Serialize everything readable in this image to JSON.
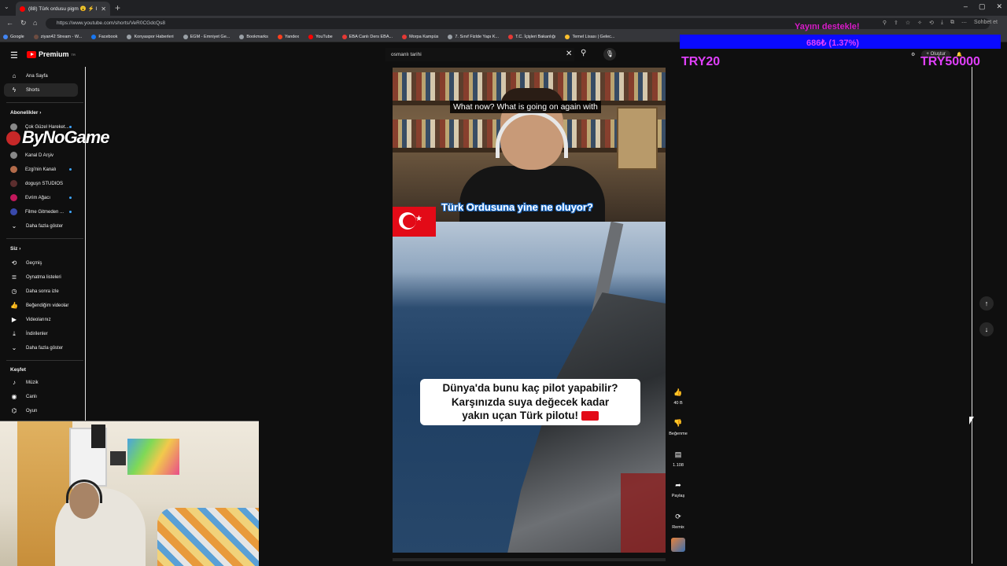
{
  "browser": {
    "tab_title": "(88) Türk ordusu pigm 😮 ⚡ I",
    "url": "https://www.youtube.com/shorts/VeR0CGdcQs8",
    "chat_label": "Sohbet et",
    "bookmarks": [
      {
        "label": "Google",
        "color": "#4285f4"
      },
      {
        "label": "ziyan42 Stream - W...",
        "color": "#6d4c41"
      },
      {
        "label": "Facebook",
        "color": "#1877f2"
      },
      {
        "label": "Konyaspor Haberleri",
        "color": "#9aa0a6"
      },
      {
        "label": "EGM - Emniyet Ge...",
        "color": "#9aa0a6"
      },
      {
        "label": "Bookmarks",
        "color": "#9aa0a6"
      },
      {
        "label": "Yandex",
        "color": "#fc3f1d"
      },
      {
        "label": "YouTube",
        "color": "#ff0000"
      },
      {
        "label": "EBA Canlı Ders EBA...",
        "color": "#e53935"
      },
      {
        "label": "Morpa Kampüs",
        "color": "#e53935"
      },
      {
        "label": "7. Sınıf Fizlde Yapı K...",
        "color": "#9aa0a6"
      },
      {
        "label": "T.C. İçişleri Bakanlığı",
        "color": "#e53935"
      },
      {
        "label": "Temel Lisası | Gelec...",
        "color": "#fbc02d"
      }
    ]
  },
  "overlay": {
    "title": "Yayını destekle!",
    "amount": "686₺ (1.37%)",
    "goal_left": "TRY20",
    "goal_right": "TRY50000"
  },
  "header": {
    "logo": "Premium",
    "logo_sup": "TR",
    "search_value": "osmanlı tarihi",
    "create_label": "Oluştur"
  },
  "sidebar": {
    "home": "Ana Sayfa",
    "shorts": "Shorts",
    "subs_head": "Abonelikler",
    "channels": [
      "Çok Güzel Hareket...",
      "Kanal D Arşiv",
      "Ezgi'nin Kanalı",
      "doguşn STUDIOS",
      "Evrim Ağacı",
      "Filme Gitmeden ..."
    ],
    "show_more_1": "Daha fazla göster",
    "you_head": "Siz",
    "you_items": [
      "Geçmiş",
      "Oynatma listeleri",
      "Daha sonra izle",
      "Beğendiğim videolar",
      "Videolarınız",
      "İndirilenler"
    ],
    "show_more_2": "Daha fazla göster",
    "explore_head": "Keşfet",
    "explore_items": [
      "Müzik",
      "Canlı",
      "Oyun"
    ],
    "watermark": "ByNoGame"
  },
  "video": {
    "caption_top": "What now? What is going on again with",
    "caption_mid": "Türk Ordusuna yine ne oluyor?",
    "caption_box_lines": [
      "Dünya'da bunu kaç pilot yapabilir?",
      "Karşınızda suya değecek kadar",
      "yakın uçan Türk pilotu!"
    ]
  },
  "actions": {
    "like_count": "40 B",
    "dislike_label": "Beğenme",
    "comment_count": "1.108",
    "share_label": "Paylaş",
    "remix_label": "Remix"
  }
}
